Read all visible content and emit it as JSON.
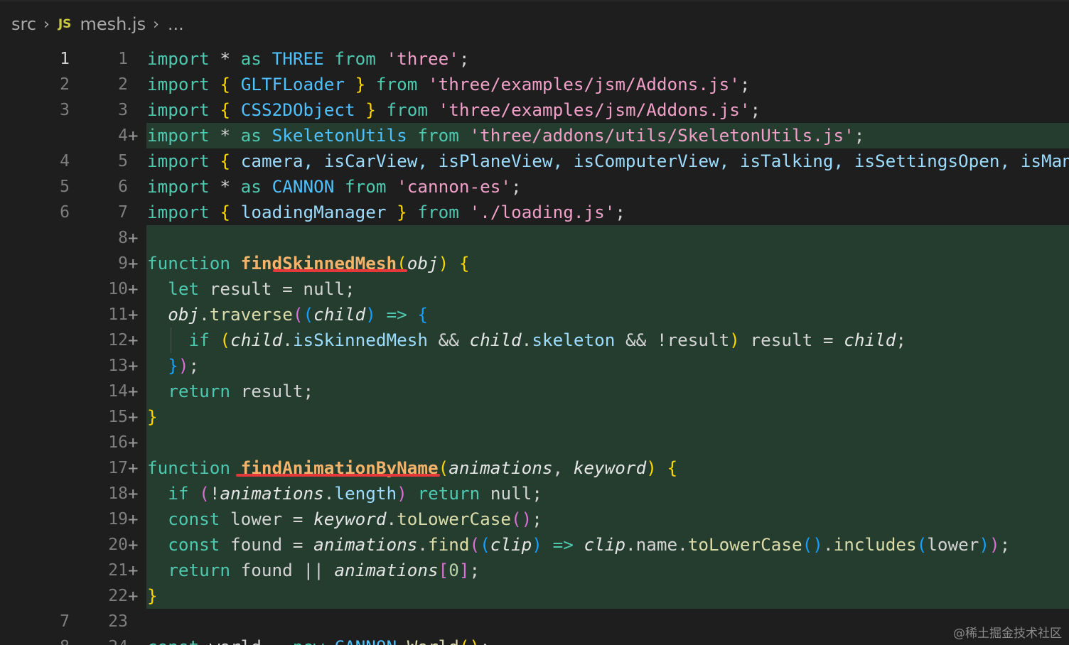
{
  "breadcrumb": {
    "folder": "src",
    "file_icon": "JS",
    "file": "mesh.js",
    "more": "..."
  },
  "colors": {
    "background": "#1e1e1e",
    "added_line_bg": "#243d2f",
    "underline_accent": "#e5383b"
  },
  "watermark": "@稀土掘金技术社区",
  "lines": [
    {
      "orig": "1",
      "mod": "1",
      "added": false,
      "current": true
    },
    {
      "orig": "2",
      "mod": "2",
      "added": false
    },
    {
      "orig": "3",
      "mod": "3",
      "added": false
    },
    {
      "orig": "",
      "mod": "4",
      "added": true
    },
    {
      "orig": "4",
      "mod": "5",
      "added": false
    },
    {
      "orig": "5",
      "mod": "6",
      "added": false
    },
    {
      "orig": "6",
      "mod": "7",
      "added": false
    },
    {
      "orig": "",
      "mod": "8",
      "added": true
    },
    {
      "orig": "",
      "mod": "9",
      "added": true
    },
    {
      "orig": "",
      "mod": "10",
      "added": true
    },
    {
      "orig": "",
      "mod": "11",
      "added": true
    },
    {
      "orig": "",
      "mod": "12",
      "added": true
    },
    {
      "orig": "",
      "mod": "13",
      "added": true
    },
    {
      "orig": "",
      "mod": "14",
      "added": true
    },
    {
      "orig": "",
      "mod": "15",
      "added": true
    },
    {
      "orig": "",
      "mod": "16",
      "added": true
    },
    {
      "orig": "",
      "mod": "17",
      "added": true
    },
    {
      "orig": "",
      "mod": "18",
      "added": true
    },
    {
      "orig": "",
      "mod": "19",
      "added": true
    },
    {
      "orig": "",
      "mod": "20",
      "added": true
    },
    {
      "orig": "",
      "mod": "21",
      "added": true
    },
    {
      "orig": "",
      "mod": "22",
      "added": true
    },
    {
      "orig": "7",
      "mod": "23",
      "added": false
    },
    {
      "orig": "8",
      "mod": "24",
      "added": false
    }
  ],
  "plus_sign": "+",
  "code": {
    "l1": {
      "a": "import",
      "b": " * ",
      "c": "as",
      "d": " THREE ",
      "e": "from",
      "f": " ",
      "g": "'three'",
      "h": ";"
    },
    "l2": {
      "a": "import",
      "b": " ",
      "c": "{",
      "d": " GLTFLoader ",
      "e": "}",
      "f": " ",
      "g": "from",
      "h": " ",
      "i": "'three/examples/jsm/Addons.js'",
      "j": ";"
    },
    "l3": {
      "a": "import",
      "b": " ",
      "c": "{",
      "d": " CSS2DObject ",
      "e": "}",
      "f": " ",
      "g": "from",
      "h": " ",
      "i": "'three/examples/jsm/Addons.js'",
      "j": ";"
    },
    "l4": {
      "a": "import",
      "b": " * ",
      "c": "as",
      "d": " SkeletonUtils ",
      "e": "from",
      "f": " ",
      "g": "'three/addons/utils/SkeletonUtils.js'",
      "h": ";"
    },
    "l5": {
      "a": "import",
      "b": " ",
      "c": "{",
      "d": " camera, isCarView, isPlaneView, isComputerView, isTalking, isSettingsOpen, isManu"
    },
    "l6": {
      "a": "import",
      "b": " * ",
      "c": "as",
      "d": " CANNON ",
      "e": "from",
      "f": " ",
      "g": "'cannon-es'",
      "h": ";"
    },
    "l7": {
      "a": "import",
      "b": " ",
      "c": "{",
      "d": " loadingManager ",
      "e": "}",
      "f": " ",
      "g": "from",
      "h": " ",
      "i": "'./loading.js'",
      "j": ";"
    },
    "l9": {
      "a": "function",
      "b": " ",
      "c": "findSkinnedMesh",
      "d": "(",
      "e": "obj",
      "f": ")",
      "g": " ",
      "h": "{"
    },
    "l10": {
      "a": "  ",
      "b": "let",
      "c": " result = null;"
    },
    "l11": {
      "a": "  ",
      "b": "obj",
      "c": ".",
      "d": "traverse",
      "e": "(",
      "f": "(",
      "g": "child",
      "h": ")",
      "i": " => ",
      "j": "{"
    },
    "l12": {
      "a": "    ",
      "b": "if",
      "c": " ",
      "d": "(",
      "e": "child",
      "f": ".",
      "g": "isSkinnedMesh",
      "h": " && ",
      "i": "child",
      "j": ".",
      "k": "skeleton",
      "l": " && !result",
      "m": ")",
      "n": " result = ",
      "o": "child",
      "p": ";"
    },
    "l13": {
      "a": "  ",
      "b": "}",
      "c": ")",
      "d": ";"
    },
    "l14": {
      "a": "  ",
      "b": "return",
      "c": " result;"
    },
    "l15": {
      "a": "}"
    },
    "l17": {
      "a": "function",
      "b": " ",
      "c": "findAnimationByName",
      "d": "(",
      "e": "animations",
      "f": ", ",
      "g": "keyword",
      "h": ")",
      "i": " ",
      "j": "{"
    },
    "l18": {
      "a": "  ",
      "b": "if",
      "c": " ",
      "d": "(",
      "e": "!",
      "f": "animations",
      "g": ".",
      "h": "length",
      "i": ")",
      "j": " ",
      "k": "return",
      "l": " null;"
    },
    "l19": {
      "a": "  ",
      "b": "const",
      "c": " lower = ",
      "d": "keyword",
      "e": ".",
      "f": "toLowerCase",
      "g": "()",
      "h": ";"
    },
    "l20": {
      "a": "  ",
      "b": "const",
      "c": " found = ",
      "d": "animations",
      "e": ".",
      "f": "find",
      "g": "(",
      "h": "(",
      "i": "clip",
      "j": ")",
      "k": " => ",
      "l": "clip",
      "m": ".name.",
      "n": "toLowerCase",
      "o": "()",
      "p": ".",
      "q": "includes",
      "r": "(",
      "s": "lower",
      "t": ")",
      "u": ")",
      "v": ";"
    },
    "l21": {
      "a": "  ",
      "b": "return",
      "c": " found || ",
      "d": "animations",
      "e": "[",
      "f": "0",
      "g": "]",
      "h": ";"
    },
    "l22": {
      "a": "}"
    },
    "l24": {
      "a": "const",
      "b": " world = ",
      "c": "new",
      "d": " CANNON",
      "e": ".",
      "f": "World",
      "g": "()",
      "h": ";"
    }
  }
}
